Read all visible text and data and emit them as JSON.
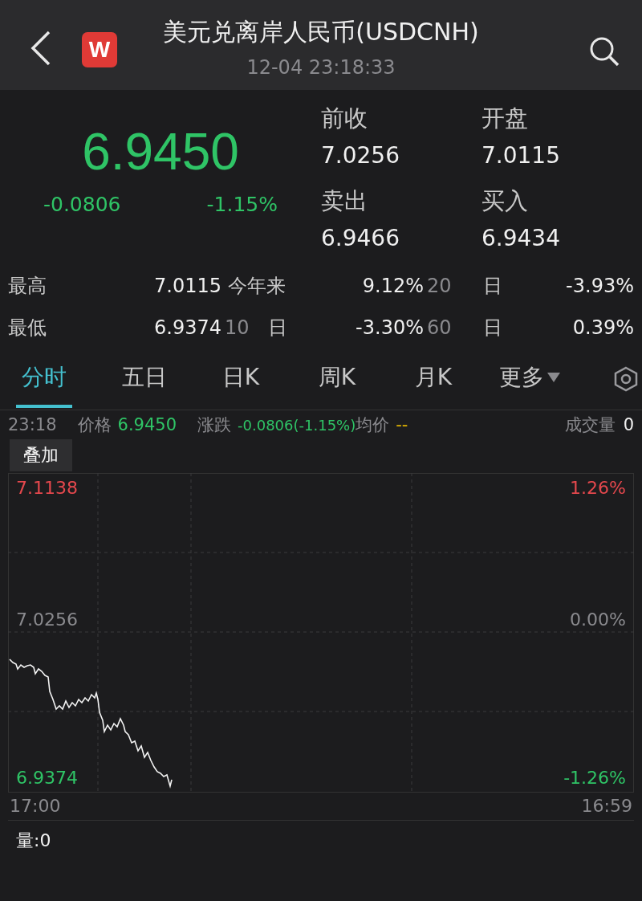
{
  "header": {
    "logo": "W",
    "title": "美元兑离岸人民币(USDCNH)",
    "timestamp": "12-04 23:18:33"
  },
  "quote": {
    "price": "6.9450",
    "change": "-0.0806",
    "change_pct": "-1.15%",
    "falling": true,
    "fields": [
      {
        "label": "前收",
        "value": "7.0256"
      },
      {
        "label": "开盘",
        "value": "7.0115"
      },
      {
        "label": "卖出",
        "value": "6.9466"
      },
      {
        "label": "买入",
        "value": "6.9434"
      }
    ]
  },
  "stats": [
    {
      "label": "最高",
      "value": "7.0115",
      "periods": [
        {
          "kind": "named",
          "name": "今年来",
          "value": "9.12%"
        },
        {
          "kind": "days",
          "days": "20",
          "unit": "日",
          "value": "-3.93%"
        }
      ]
    },
    {
      "label": "最低",
      "value": "6.9374",
      "periods": [
        {
          "kind": "days",
          "days": "10",
          "unit": "日",
          "value": "-3.30%"
        },
        {
          "kind": "days",
          "days": "60",
          "unit": "日",
          "value": "0.39%"
        }
      ]
    }
  ],
  "tabs": [
    {
      "label": "分时",
      "selected": true,
      "dropdown": false
    },
    {
      "label": "五日",
      "selected": false,
      "dropdown": false
    },
    {
      "label": "日K",
      "selected": false,
      "dropdown": false
    },
    {
      "label": "周K",
      "selected": false,
      "dropdown": false
    },
    {
      "label": "月K",
      "selected": false,
      "dropdown": false
    },
    {
      "label": "更多",
      "selected": false,
      "dropdown": true
    }
  ],
  "info": {
    "time": "23:18",
    "price_label": "价格",
    "price": "6.9450",
    "change_label": "涨跌",
    "change": "-0.0806(-1.15%)",
    "avg_label": "均价",
    "avg": "--",
    "volume_label": "成交量",
    "volume": "0"
  },
  "overlay_button": "叠加",
  "chart": {
    "top_price": "7.1138",
    "top_pct": "1.26%",
    "mid_price": "7.0256",
    "mid_pct": "0.00%",
    "bottom_price": "6.9374",
    "bottom_pct": "-1.26%",
    "start_time": "17:00",
    "end_time": "16:59",
    "volume": "量:0"
  }
}
